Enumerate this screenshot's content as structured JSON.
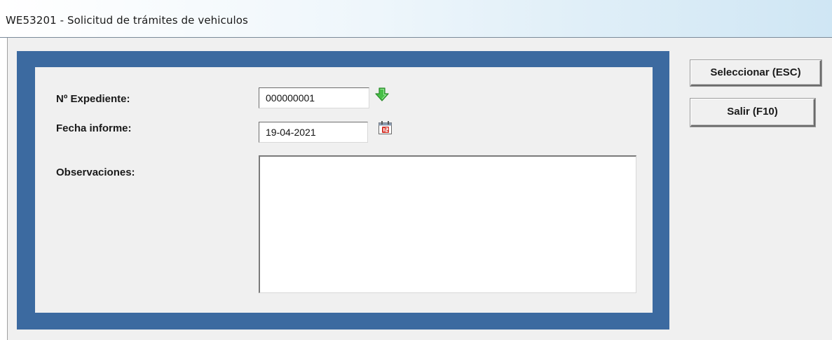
{
  "window": {
    "title": "WE53201 - Solicitud de trámites de vehiculos"
  },
  "form": {
    "expediente": {
      "label": "Nº Expediente:",
      "value": "000000001",
      "action_icon": "green-down-arrow-icon"
    },
    "fecha_informe": {
      "label": "Fecha informe:",
      "value": "19-04-2021",
      "action_icon": "calendar-icon"
    },
    "observaciones": {
      "label": "Observaciones:",
      "value": ""
    }
  },
  "buttons": {
    "seleccionar": "Seleccionar (ESC)",
    "salir": "Salir (F10)"
  },
  "colors": {
    "frame_border": "#3c6aa0",
    "panel_background": "#f0f0f0",
    "arrow_green": "#3bb33b",
    "calendar_red": "#d4342a"
  }
}
